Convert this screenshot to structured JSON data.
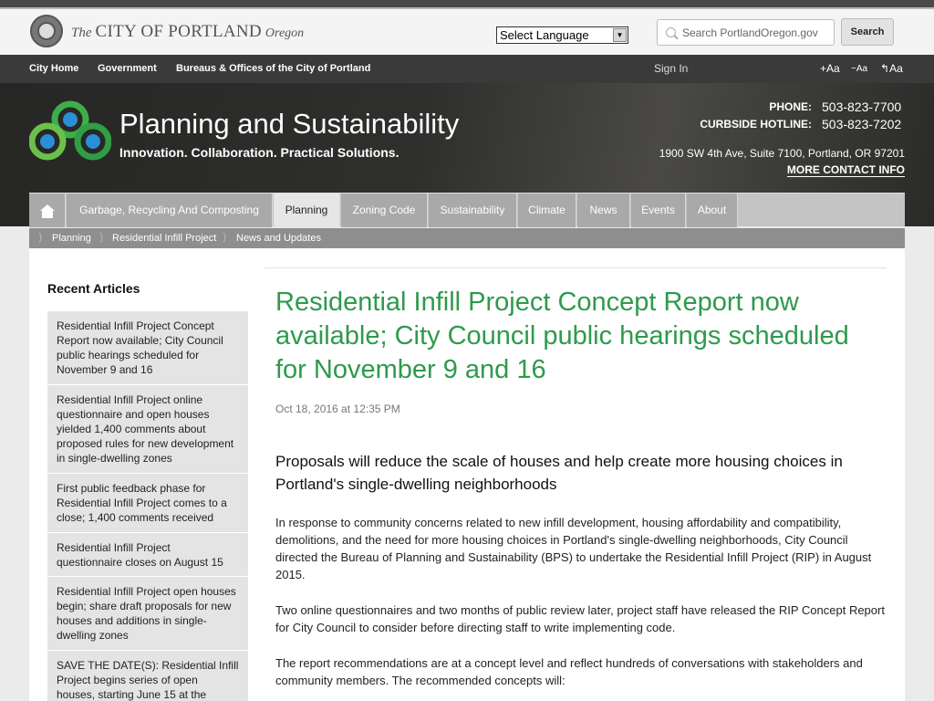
{
  "city": {
    "the": "The",
    "name": "CITY OF PORTLAND",
    "state": "Oregon"
  },
  "language": {
    "selected": "Select Language"
  },
  "search": {
    "placeholder": "Search PortlandOregon.gov",
    "button": "Search"
  },
  "topnav": {
    "city_home": "City Home",
    "government": "Government",
    "bureaus": "Bureaus & Offices of the City of Portland",
    "sign_in": "Sign In",
    "font_increase": "+Aa",
    "font_decrease": "−Aa",
    "font_reset": "Aa"
  },
  "bureau": {
    "name": "Planning and Sustainability",
    "tagline": "Innovation. Collaboration. Practical Solutions."
  },
  "contact": {
    "phone_label": "PHONE:",
    "phone": "503-823-7700",
    "hotline_label": "CURBSIDE HOTLINE:",
    "hotline": "503-823-7202",
    "address": "1900 SW 4th Ave, Suite 7100, Portland, OR 97201",
    "more": "MORE CONTACT INFO"
  },
  "menu": [
    "Garbage, Recycling And Composting",
    "Planning",
    "Zoning Code",
    "Sustainability",
    "Climate",
    "News",
    "Events",
    "About"
  ],
  "breadcrumbs": [
    "Planning",
    "Residential Infill Project",
    "News and Updates"
  ],
  "sidebar": {
    "title": "Recent Articles",
    "articles": [
      "Residential Infill Project Concept Report now available; City Council public hearings scheduled for November 9 and 16",
      "Residential Infill Project online questionnaire and open houses yielded 1,400 comments about proposed rules for new development in single-dwelling zones",
      "First public feedback phase for Residential Infill Project comes to a close; 1,400 comments received",
      "Residential Infill Project questionnaire closes on August 15",
      "Residential Infill Project open houses begin; share draft proposals for new houses and additions in single-dwelling zones",
      "SAVE THE DATE(S): Residential Infill Project begins series of open houses, starting June 15 at the"
    ]
  },
  "article": {
    "title": "Residential Infill Project Concept Report now available; City Council public hearings scheduled for November 9 and 16",
    "date": "Oct 18, 2016 at 12:35 PM",
    "lede": "Proposals will reduce the scale of houses and help create more housing choices in Portland's single-dwelling neighborhoods",
    "p1": "In response to community concerns related to new infill development, housing affordability and compatibility, demolitions, and the need for more housing choices in Portland's single-dwelling neighborhoods, City Council directed the Bureau of Planning and Sustainability (BPS) to undertake the Residential Infill Project (RIP) in August 2015.",
    "p2": "Two online questionnaires and two months of public review later, project staff have released the RIP Concept Report for City Council to consider before directing staff to write implementing code.",
    "p3": "The report recommendations are at a concept level and reflect hundreds of conversations with stakeholders and community members. The recommended concepts will:"
  },
  "colors": {
    "accent_green": "#2e9a4c",
    "header_dark": "#2f2f2d",
    "menu_gray": "#a9a9a9"
  }
}
